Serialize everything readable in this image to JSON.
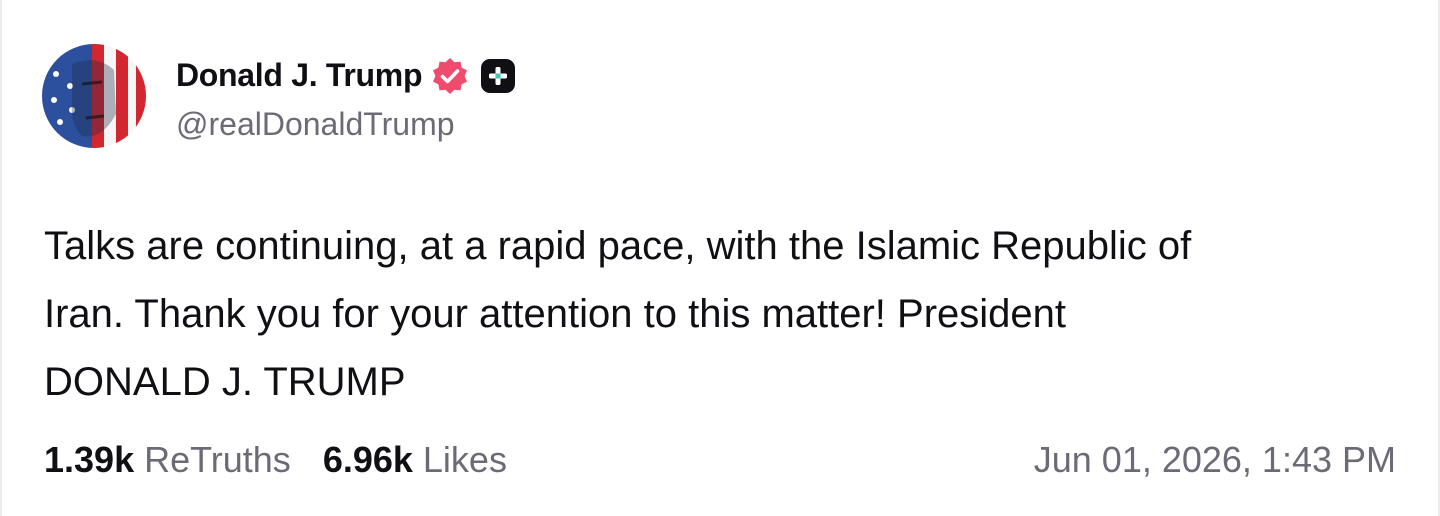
{
  "post": {
    "author": {
      "display_name": "Donald J. Trump",
      "handle": "@realDonaldTrump",
      "avatar_icon": "avatar-flag-portrait",
      "verified_icon": "verified-badge-icon",
      "plus_icon": "plus-badge-icon"
    },
    "text": "Talks are continuing, at a rapid pace, with the Islamic Republic of\nIran. Thank you for your attention to this matter! President\nDONALD J. TRUMP",
    "stats": {
      "retruths_count": "1.39k",
      "retruths_label": "ReTruths",
      "likes_count": "6.96k",
      "likes_label": "Likes"
    },
    "timestamp": "Jun 01, 2026, 1:43 PM"
  },
  "colors": {
    "text_primary": "#0f0f14",
    "text_secondary": "#6b6b78",
    "verified_badge": "#f04a6c",
    "plus_badge_bg": "#0f0f14",
    "background": "#ffffff"
  }
}
